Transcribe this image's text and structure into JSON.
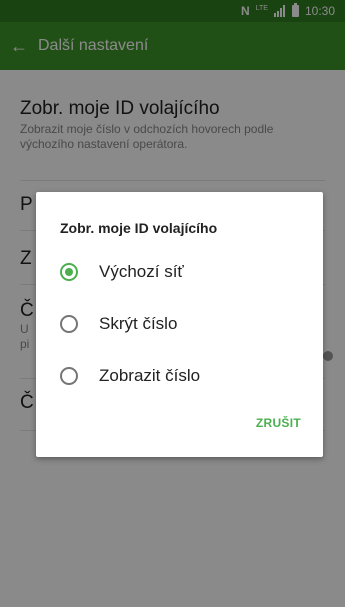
{
  "status_bar": {
    "nfc": "N",
    "lte": "LTE",
    "time": "10:30"
  },
  "app_bar": {
    "back_icon": "←",
    "title": "Další nastavení"
  },
  "settings": {
    "caller_id": {
      "title": "Zobr. moje ID volajícího",
      "subtitle": "Zobrazit moje číslo v odchozích hovorech podle výchozího nastavení operátora."
    },
    "row2_letter": "P",
    "row3_letter": "Z",
    "row4_letter": "Č",
    "row4_sub_a": "U",
    "row4_sub_b": "pi",
    "row5_letter": "Č"
  },
  "dialog": {
    "title": "Zobr. moje ID volajícího",
    "options": [
      {
        "label": "Výchozí síť",
        "selected": true
      },
      {
        "label": "Skrýt číslo",
        "selected": false
      },
      {
        "label": "Zobrazit číslo",
        "selected": false
      }
    ],
    "cancel_label": "ZRUŠIT"
  },
  "colors": {
    "status_bar": "#2f7d1f",
    "app_bar": "#3d9529",
    "accent": "#4caf50"
  }
}
